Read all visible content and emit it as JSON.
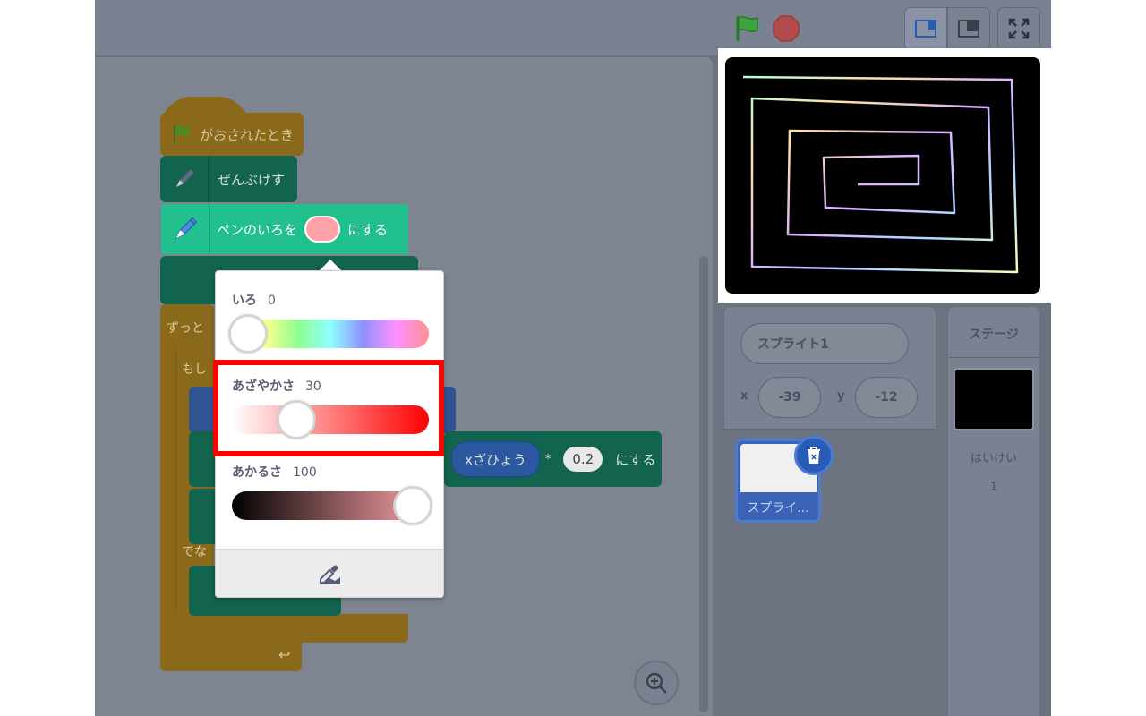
{
  "blocks": {
    "hat_label": "がおされたとき",
    "clear_label": "ぜんぶけす",
    "set_color_prefix": "ペンのいろを",
    "set_color_suffix": "にする",
    "forever_label": "ずっと",
    "if_label": "もし",
    "else_label": "でな",
    "expr_reporter": "xざひょう",
    "expr_operator": "*",
    "expr_value": "0.2",
    "expr_suffix": "にする"
  },
  "color_picker": {
    "hue_label": "いろ",
    "hue_value": "0",
    "saturation_label": "あざやかさ",
    "saturation_value": "30",
    "brightness_label": "あかるさ",
    "brightness_value": "100",
    "hue_position": 0,
    "saturation_position": 0.3,
    "brightness_position": 1
  },
  "sprite_info": {
    "name": "スプライト1",
    "x_label": "x",
    "x_value": "-39",
    "y_label": "y",
    "y_value": "-12",
    "thumb_label": "スプライ..."
  },
  "stage_pane": {
    "title": "ステージ",
    "backdrop_label": "はいけい",
    "backdrop_count": "1"
  },
  "colors": {
    "accent": "#22c08e",
    "highlight": "#ff0000",
    "pen_color": "#ffa3a8"
  }
}
